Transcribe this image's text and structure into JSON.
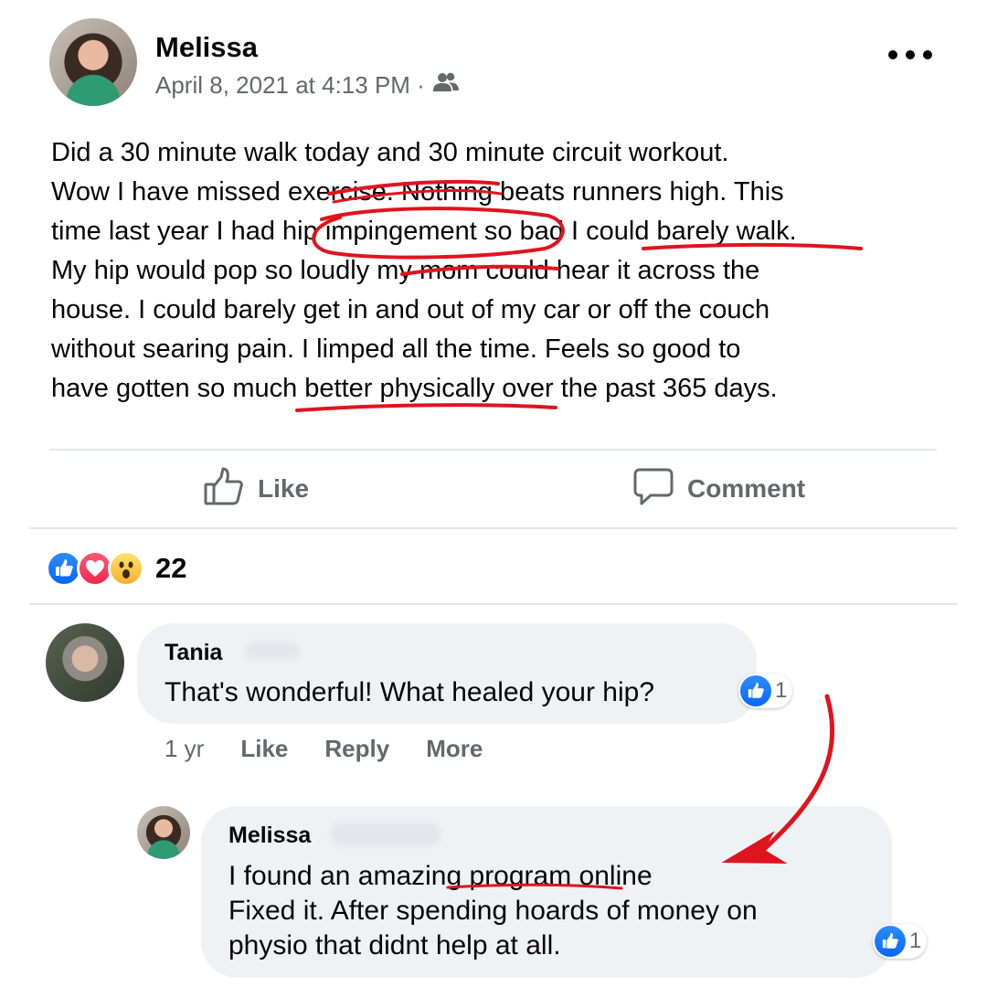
{
  "post": {
    "author": "Melissa",
    "timestamp": "April 8, 2021 at 4:13 PM ·",
    "audience_icon": "friends-icon",
    "more_icon": "more-dots-icon",
    "lines": [
      "Did a 30 minute walk today and 30 minute circuit workout.",
      "Wow I have missed exercise. Nothing beats runners high. This",
      "time last year I had hip impingement so bad I could barely walk.",
      "My hip would pop so loudly my mom could hear it across the",
      "house. I could barely get in and out of my car or off the couch",
      "without searing pain. I limped all the time. Feels so good to",
      "have gotten so much better physically over the past 365 days."
    ]
  },
  "actions": {
    "like": "Like",
    "comment": "Comment"
  },
  "reactions": {
    "types": [
      "like",
      "love",
      "wow"
    ],
    "count": "22"
  },
  "comments": [
    {
      "author": "Tania",
      "text": "That's wonderful! What healed your hip?",
      "like_count": "1",
      "time": "1 yr",
      "actions": [
        "Like",
        "Reply",
        "More"
      ]
    }
  ],
  "reply": {
    "author": "Melissa",
    "lines": [
      "I found an amazing program online",
      "Fixed it. After spending hoards of money on",
      "physio that didnt help at all."
    ],
    "like_count": "1"
  },
  "colors": {
    "text": "#050505",
    "secondary": "#65676b",
    "bubble": "#eff2f5",
    "divider": "#e4e6eb",
    "like_blue": "#0866ff",
    "annotation_red": "#e0141e"
  }
}
